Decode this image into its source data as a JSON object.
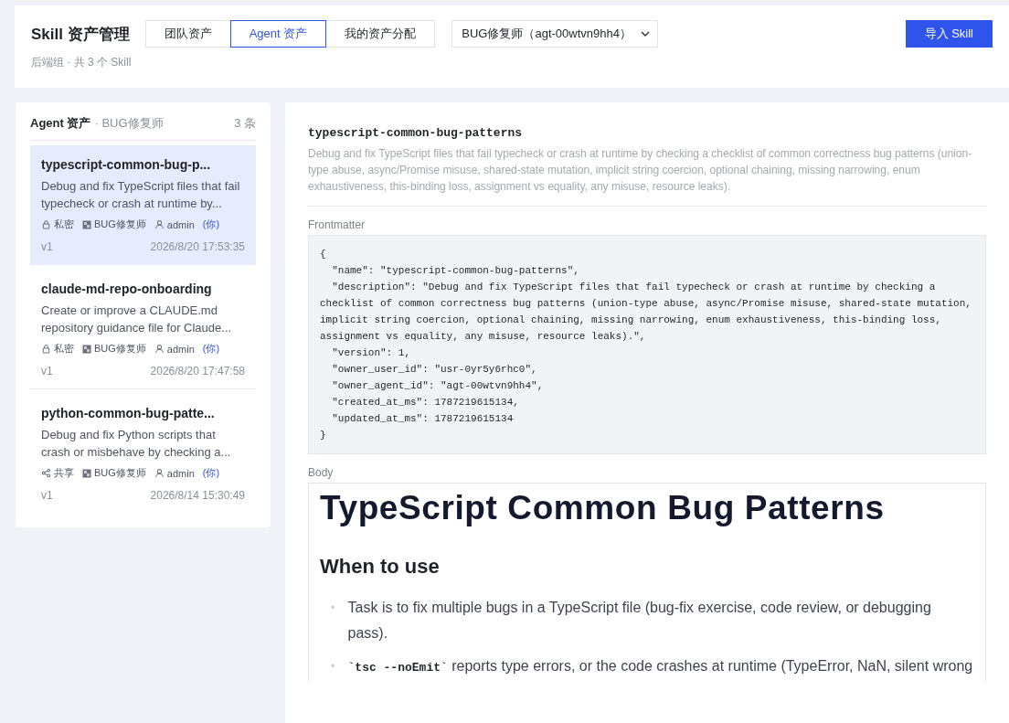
{
  "header": {
    "title": "Skill 资产管理",
    "subtitle": "后端组 · 共 3 个 Skill",
    "tabs": [
      {
        "label": "团队资产",
        "selected": false
      },
      {
        "label": "Agent 资产",
        "selected": true
      },
      {
        "label": "我的资产分配",
        "selected": false
      }
    ],
    "agent_select": {
      "value": "BUG修复师（agt-00wtvn9hh4）"
    },
    "import_button": "导入 Skill"
  },
  "list_panel": {
    "title": "Agent 资产",
    "subtitle": "· BUG修复师",
    "count": "3 条",
    "items": [
      {
        "name": "typescript-common-bug-p...",
        "description": "Debug and fix TypeScript files that fail typecheck or crash at runtime by...",
        "visibility": {
          "kind": "private",
          "label": "私密"
        },
        "agent": "BUG修复师",
        "owner": "admin",
        "you": "(你)",
        "version": "v1",
        "time": "2026/8/20 17:53:35",
        "selected": true
      },
      {
        "name": "claude-md-repo-onboarding",
        "description": "Create or improve a CLAUDE.md repository guidance file for Claude...",
        "visibility": {
          "kind": "private",
          "label": "私密"
        },
        "agent": "BUG修复师",
        "owner": "admin",
        "you": "(你)",
        "version": "v1",
        "time": "2026/8/20 17:47:58",
        "selected": false
      },
      {
        "name": "python-common-bug-patte...",
        "description": "Debug and fix Python scripts that crash or misbehave by checking a...",
        "visibility": {
          "kind": "shared",
          "label": "共享"
        },
        "agent": "BUG修复师",
        "owner": "admin",
        "you": "(你)",
        "version": "v1",
        "time": "2026/8/14 15:30:49",
        "selected": false
      }
    ]
  },
  "detail": {
    "name": "typescript-common-bug-patterns",
    "description": "Debug and fix TypeScript files that fail typecheck or crash at runtime by checking a checklist of common correctness bug patterns (union-type abuse, async/Promise misuse, shared-state mutation, implicit string coercion, optional chaining, missing narrowing, enum exhaustiveness, this-binding loss, assignment vs equality, any misuse, resource leaks).",
    "frontmatter_label": "Frontmatter",
    "frontmatter": "{\n  \"name\": \"typescript-common-bug-patterns\",\n  \"description\": \"Debug and fix TypeScript files that fail typecheck or crash at runtime by checking a checklist of common correctness bug patterns (union-type abuse, async/Promise misuse, shared-state mutation, implicit string coercion, optional chaining, missing narrowing, enum exhaustiveness, this-binding loss, assignment vs equality, any misuse, resource leaks).\",\n  \"version\": 1,\n  \"owner_user_id\": \"usr-0yr5y6rhc0\",\n  \"owner_agent_id\": \"agt-00wtvn9hh4\",\n  \"created_at_ms\": 1787219615134,\n  \"updated_at_ms\": 1787219615134\n}",
    "body_label": "Body",
    "body": {
      "h1": "TypeScript Common Bug Patterns",
      "h2": "When to use",
      "bullets": [
        {
          "marker": "•",
          "text": "Task is to fix multiple bugs in a TypeScript file (bug-fix exercise, code review, or debugging pass)."
        },
        {
          "marker": "•",
          "code": "`tsc --noEmit`",
          "text": " reports type errors, or the code crashes at runtime (TypeError, NaN, silent wrong"
        }
      ]
    }
  }
}
